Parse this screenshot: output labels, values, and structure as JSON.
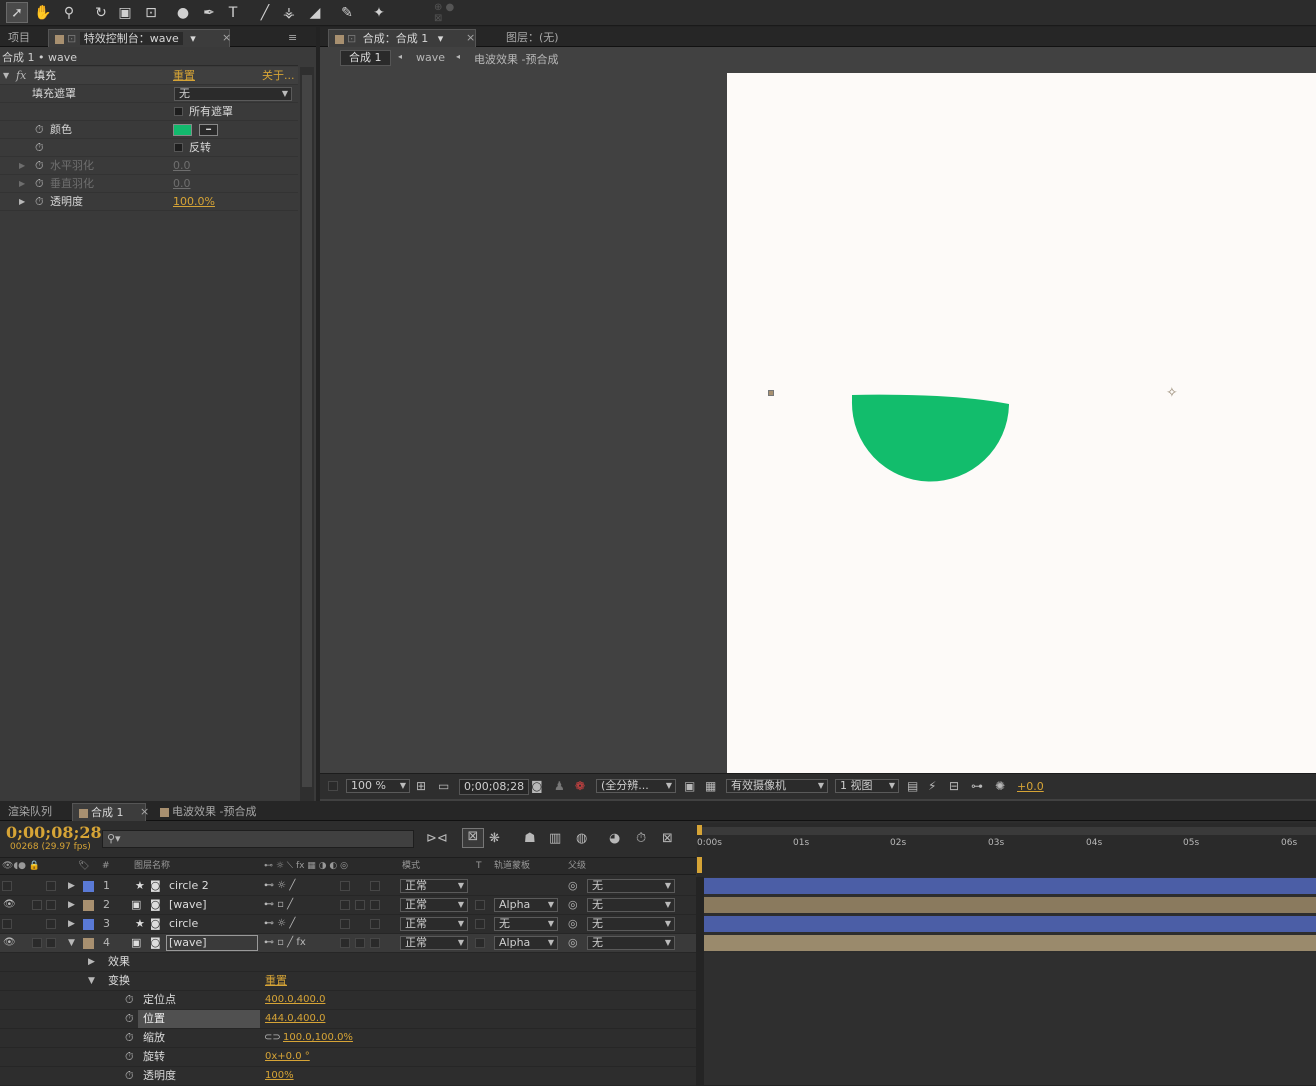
{
  "toolbar": {
    "tools": [
      "selection-tool",
      "hand-tool",
      "zoom-tool",
      "rotation-tool",
      "camera-tool",
      "pan-behind-tool",
      "ellipse-tool",
      "pen-tool",
      "type-tool",
      "brush-tool",
      "clone-stamp-tool",
      "eraser-tool",
      "roto-brush-tool",
      "puppet-tool"
    ],
    "type_glyph": "T"
  },
  "left_panel": {
    "tab_project": "项目",
    "tab_effects": "特效控制台：wave",
    "breadcrumb": "合成 1 • wave",
    "effect_name": "填充",
    "fx_glyph": "fx",
    "reset": "重置",
    "about": "关于...",
    "rows": {
      "fill_mask": {
        "label": "填充遮罩",
        "value": "无"
      },
      "all_masks": {
        "label": "所有遮罩"
      },
      "color": {
        "label": "颜色",
        "value_color": "#12b96d"
      },
      "invert": {
        "label": "反转"
      },
      "h_feather": {
        "label": "水平羽化",
        "value": "0.0"
      },
      "v_feather": {
        "label": "垂直羽化",
        "value": "0.0"
      },
      "opacity": {
        "label": "透明度",
        "value": "100.0%"
      }
    }
  },
  "viewer": {
    "tab_comp": "合成：合成 1",
    "tab_layer": "图层：(无)",
    "crumbs": [
      "合成 1",
      "wave",
      "电波效果 -预合成"
    ],
    "zoom": "100 %",
    "timecode": "0;00;08;28",
    "resolution": "(全分辨...",
    "camera": "有效摄像机",
    "views": "1 视图",
    "exposure": "+0.0",
    "shape_color": "#12bd6c"
  },
  "timeline": {
    "tab_render": "渲染队列",
    "tab_comp": "合成 1",
    "tab_precomp": "电波效果 -预合成",
    "current_time": "0;00;08;28",
    "frame_info": "00268 (29.97 fps)",
    "search_placeholder": "",
    "headers": {
      "num": "#",
      "layer_name": "图层名称",
      "mode": "模式",
      "t": "T",
      "track_matte": "轨道蒙板",
      "parent": "父级"
    },
    "ruler": [
      "0:00s",
      "01s",
      "02s",
      "03s",
      "04s",
      "05s",
      "06s"
    ],
    "layers": [
      {
        "num": "1",
        "name": "circle 2",
        "mode": "正常",
        "matte": "",
        "parent": "无",
        "color": "#5a7ad6"
      },
      {
        "num": "2",
        "name": "[wave]",
        "mode": "正常",
        "matte": "Alpha",
        "parent": "无",
        "color": "#a89070"
      },
      {
        "num": "3",
        "name": "circle",
        "mode": "正常",
        "matte": "无",
        "parent": "无",
        "color": "#5a7ad6"
      },
      {
        "num": "4",
        "name": "[wave]",
        "mode": "正常",
        "matte": "Alpha",
        "parent": "无",
        "color": "#a89070"
      }
    ],
    "props": {
      "effects": "效果",
      "transform": "变换",
      "reset": "重置",
      "anchor": {
        "label": "定位点",
        "value": "400.0,400.0"
      },
      "position": {
        "label": "位置",
        "value": "444.0,400.0"
      },
      "scale": {
        "label": "缩放",
        "value": "100.0,100.0%"
      },
      "rotation": {
        "label": "旋转",
        "value": "0x+0.0 °"
      },
      "opacity": {
        "label": "透明度",
        "value": "100%"
      }
    }
  }
}
